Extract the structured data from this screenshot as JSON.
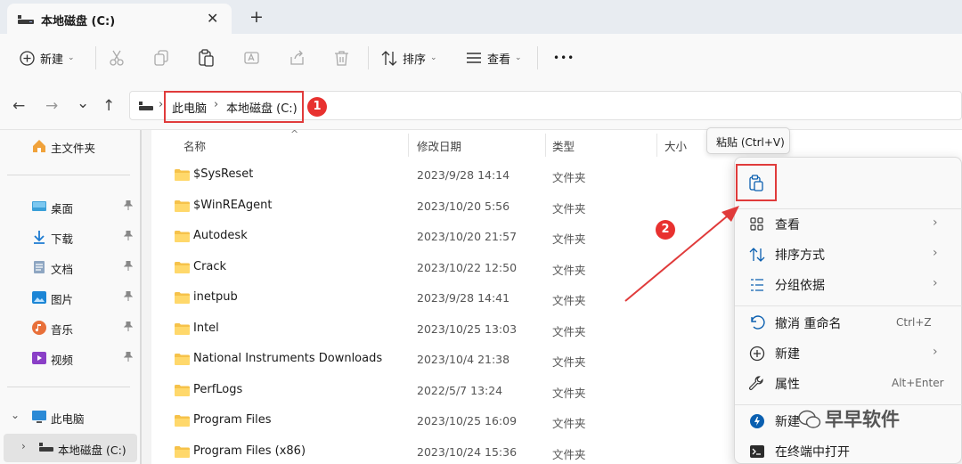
{
  "window": {
    "tab_title": "本地磁盘 (C:)",
    "close_glyph": "✕",
    "newtab_glyph": "+"
  },
  "toolbar": {
    "new_label": "新建",
    "sort_label": "排序",
    "view_label": "查看",
    "more_glyph": "•••",
    "dropdown_glyph": "⌄"
  },
  "nav": {
    "back": "←",
    "forward": "→",
    "recent": "⌄",
    "up": "↑"
  },
  "breadcrumb": {
    "sep": "›",
    "items": [
      "此电脑",
      "本地磁盘 (C:)"
    ]
  },
  "annotations": {
    "badge1": "1",
    "badge2": "2"
  },
  "sidebar": {
    "home": "主文件夹",
    "pinned": [
      {
        "label": "桌面",
        "icon": "desktop-icon"
      },
      {
        "label": "下载",
        "icon": "download-icon"
      },
      {
        "label": "文档",
        "icon": "document-icon"
      },
      {
        "label": "图片",
        "icon": "picture-icon"
      },
      {
        "label": "音乐",
        "icon": "music-icon"
      },
      {
        "label": "视频",
        "icon": "video-icon"
      }
    ],
    "pin_glyph": "📌",
    "this_pc": "此电脑",
    "local_disk": "本地磁盘 (C:)",
    "expand_open": "⌄",
    "expand_closed": "›"
  },
  "columns": {
    "name": "名称",
    "date": "修改日期",
    "type": "类型",
    "size": "大小",
    "sort_glyph": "^"
  },
  "files": [
    {
      "name": "$SysReset",
      "date": "2023/9/28 14:14",
      "type": "文件夹"
    },
    {
      "name": "$WinREAgent",
      "date": "2023/10/20 5:56",
      "type": "文件夹"
    },
    {
      "name": "Autodesk",
      "date": "2023/10/20 21:57",
      "type": "文件夹"
    },
    {
      "name": "Crack",
      "date": "2023/10/22 12:50",
      "type": "文件夹"
    },
    {
      "name": "inetpub",
      "date": "2023/9/28 14:41",
      "type": "文件夹"
    },
    {
      "name": "Intel",
      "date": "2023/10/25 13:03",
      "type": "文件夹"
    },
    {
      "name": "National Instruments Downloads",
      "date": "2023/10/4 21:38",
      "type": "文件夹"
    },
    {
      "name": "PerfLogs",
      "date": "2022/5/7 13:24",
      "type": "文件夹"
    },
    {
      "name": "Program Files",
      "date": "2023/10/25 16:09",
      "type": "文件夹"
    },
    {
      "name": "Program Files (x86)",
      "date": "2023/10/24 15:36",
      "type": "文件夹"
    }
  ],
  "tooltip": "粘贴 (Ctrl+V)",
  "context_menu": {
    "arrow": "›",
    "view": "查看",
    "sort": "排序方式",
    "group": "分组依据",
    "undo": "撤消 重命名",
    "undo_shortcut": "Ctrl+Z",
    "new": "新建",
    "properties": "属性",
    "properties_shortcut": "Alt+Enter",
    "share": "新建",
    "terminal": "在终端中打开"
  },
  "watermark": "早早软件",
  "colors": {
    "accent": "#0067c0",
    "annotation_red": "#e03b3b",
    "folder_yellow": "#f6c24a"
  }
}
